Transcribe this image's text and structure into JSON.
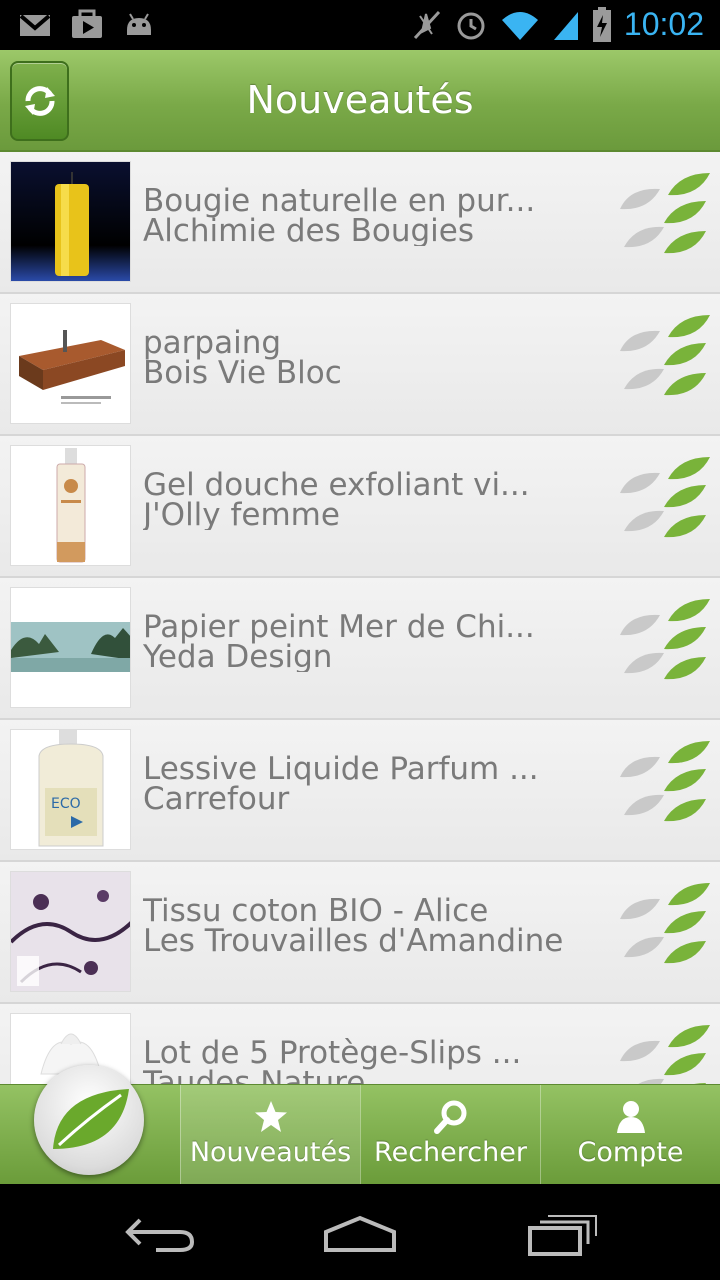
{
  "status_bar": {
    "time": "10:02",
    "left_icons": [
      "gmail-icon",
      "play-store-icon",
      "android-icon"
    ],
    "right_icons": [
      "mute-icon",
      "alarm-icon",
      "wifi-icon",
      "signal-icon",
      "battery-charging-icon"
    ]
  },
  "header": {
    "title": "Nouveautés",
    "refresh_icon": "refresh-icon"
  },
  "items": [
    {
      "title": "Bougie naturelle en pur...",
      "subtitle": "Alchimie des Bougies",
      "thumb": "yellow-candle"
    },
    {
      "title": "parpaing",
      "subtitle": "Bois Vie Bloc",
      "thumb": "wood-block"
    },
    {
      "title": "Gel douche exfoliant vi...",
      "subtitle": "J'Olly femme",
      "thumb": "shower-gel-bottle"
    },
    {
      "title": "Papier peint Mer de Chi...",
      "subtitle": "Yeda Design",
      "thumb": "sea-wallpaper"
    },
    {
      "title": "Lessive Liquide Parfum ...",
      "subtitle": "Carrefour",
      "thumb": "detergent-bottle"
    },
    {
      "title": "Tissu coton BIO - Alice",
      "subtitle": "Les Trouvailles d'Amandine",
      "thumb": "floral-fabric"
    },
    {
      "title": "Lot de 5 Protège-Slips ...",
      "subtitle": "Taudes Nature",
      "thumb": "panty-liners"
    }
  ],
  "rating_icon": "leaves-rating-icon",
  "bottom_nav": {
    "logo_icon": "leaf-logo-icon",
    "tabs": [
      {
        "label": "Nouveautés",
        "icon": "star-icon",
        "active": true
      },
      {
        "label": "Rechercher",
        "icon": "search-icon",
        "active": false
      },
      {
        "label": "Compte",
        "icon": "person-icon",
        "active": false
      }
    ]
  },
  "system_nav": [
    "back-icon",
    "home-icon",
    "recent-apps-icon"
  ],
  "colors": {
    "header_green": "#7aa948",
    "text_gray": "#7a7a7a",
    "status_blue": "#3ab4f2"
  }
}
